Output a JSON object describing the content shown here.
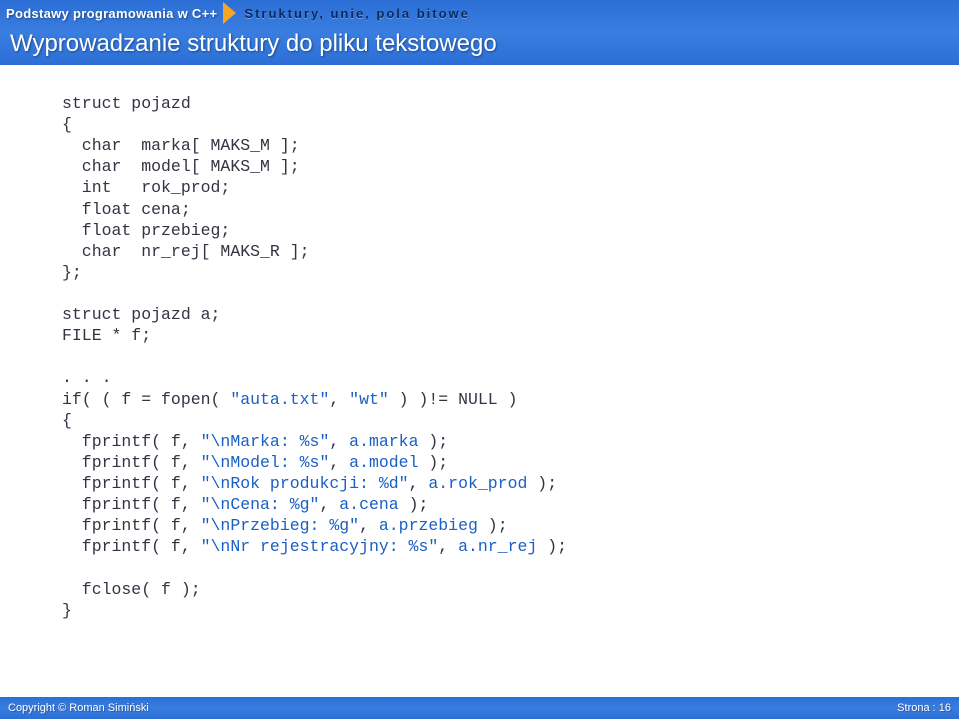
{
  "header": {
    "breadcrumb1": "Podstawy programowania w C++",
    "breadcrumb2": "Struktury, unie, pola bitowe",
    "title": "Wyprowadzanie struktury do pliku tekstowego"
  },
  "code": {
    "l01": "struct pojazd",
    "l02": "{",
    "l03": "  char  marka[ MAKS_M ];",
    "l04": "  char  model[ MAKS_M ];",
    "l05": "  int   rok_prod;",
    "l06": "  float cena;",
    "l07": "  float przebieg;",
    "l08": "  char  nr_rej[ MAKS_R ];",
    "l09": "};",
    "l10": "",
    "l11": "struct pojazd a;",
    "l12": "FILE * f;",
    "l13": "",
    "l14": ". . .",
    "l15a": "if( ( f = fopen( ",
    "l15b": "\"auta.txt\"",
    "l15c": ", ",
    "l15d": "\"wt\"",
    "l15e": " ) )!= NULL )",
    "l16": "{",
    "l17a": "  fprintf( f, ",
    "l17b": "\"\\nMarka: %s\"",
    "l17c": ", ",
    "l17d": "a.marka",
    "l17e": " );",
    "l18a": "  fprintf( f, ",
    "l18b": "\"\\nModel: %s\"",
    "l18c": ", ",
    "l18d": "a.model",
    "l18e": " );",
    "l19a": "  fprintf( f, ",
    "l19b": "\"\\nRok produkcji: %d\"",
    "l19c": ", ",
    "l19d": "a.rok_prod",
    "l19e": " );",
    "l20a": "  fprintf( f, ",
    "l20b": "\"\\nCena: %g\"",
    "l20c": ", ",
    "l20d": "a.cena",
    "l20e": " );",
    "l21a": "  fprintf( f, ",
    "l21b": "\"\\nPrzebieg: %g\"",
    "l21c": ", ",
    "l21d": "a.przebieg",
    "l21e": " );",
    "l22a": "  fprintf( f, ",
    "l22b": "\"\\nNr rejestracyjny: %s\"",
    "l22c": ", ",
    "l22d": "a.nr_rej",
    "l22e": " );",
    "l23": "",
    "l24": "  fclose( f );",
    "l25": "}"
  },
  "footer": {
    "left": "Copyright © Roman Simiński",
    "right_label": "Strona : ",
    "right_page": "16"
  }
}
